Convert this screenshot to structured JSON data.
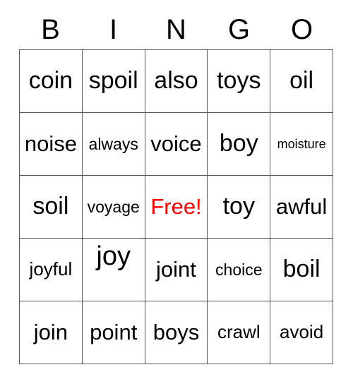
{
  "card": {
    "title": "BINGO",
    "header_letters": [
      "B",
      "I",
      "N",
      "G",
      "O"
    ],
    "free_space_label": "Free!",
    "free_space_color": "#ff0000",
    "text_color": "#000000",
    "border_color": "#555555",
    "background_color": "#ffffff",
    "columns": 5,
    "rows": 5,
    "cells": [
      [
        {
          "text": "coin",
          "size": "fs-lg",
          "free": false
        },
        {
          "text": "spoil",
          "size": "fs-lg",
          "free": false
        },
        {
          "text": "also",
          "size": "fs-lg",
          "free": false
        },
        {
          "text": "toys",
          "size": "fs-lg",
          "free": false
        },
        {
          "text": "oil",
          "size": "fs-lg",
          "free": false
        }
      ],
      [
        {
          "text": "noise",
          "size": "fs-md",
          "free": false
        },
        {
          "text": "always",
          "size": "fs-xs",
          "free": false
        },
        {
          "text": "voice",
          "size": "fs-md",
          "free": false
        },
        {
          "text": "boy",
          "size": "fs-lg",
          "free": false
        },
        {
          "text": "moisture",
          "size": "fs-xxs",
          "free": false
        }
      ],
      [
        {
          "text": "soil",
          "size": "fs-lg",
          "free": false
        },
        {
          "text": "voyage",
          "size": "fs-xs",
          "free": false
        },
        {
          "text": "Free!",
          "size": "fs-md",
          "free": true
        },
        {
          "text": "toy",
          "size": "fs-lg",
          "free": false
        },
        {
          "text": "awful",
          "size": "fs-md",
          "free": false
        }
      ],
      [
        {
          "text": "joyful",
          "size": "fs-sm",
          "free": false
        },
        {
          "text": "joy",
          "size": "fs-xl",
          "free": false
        },
        {
          "text": "joint",
          "size": "fs-md",
          "free": false
        },
        {
          "text": "choice",
          "size": "fs-xs",
          "free": false
        },
        {
          "text": "boil",
          "size": "fs-lg",
          "free": false
        }
      ],
      [
        {
          "text": "join",
          "size": "fs-md",
          "free": false
        },
        {
          "text": "point",
          "size": "fs-md",
          "free": false
        },
        {
          "text": "boys",
          "size": "fs-md",
          "free": false
        },
        {
          "text": "crawl",
          "size": "fs-sm",
          "free": false
        },
        {
          "text": "avoid",
          "size": "fs-sm",
          "free": false
        }
      ]
    ]
  }
}
